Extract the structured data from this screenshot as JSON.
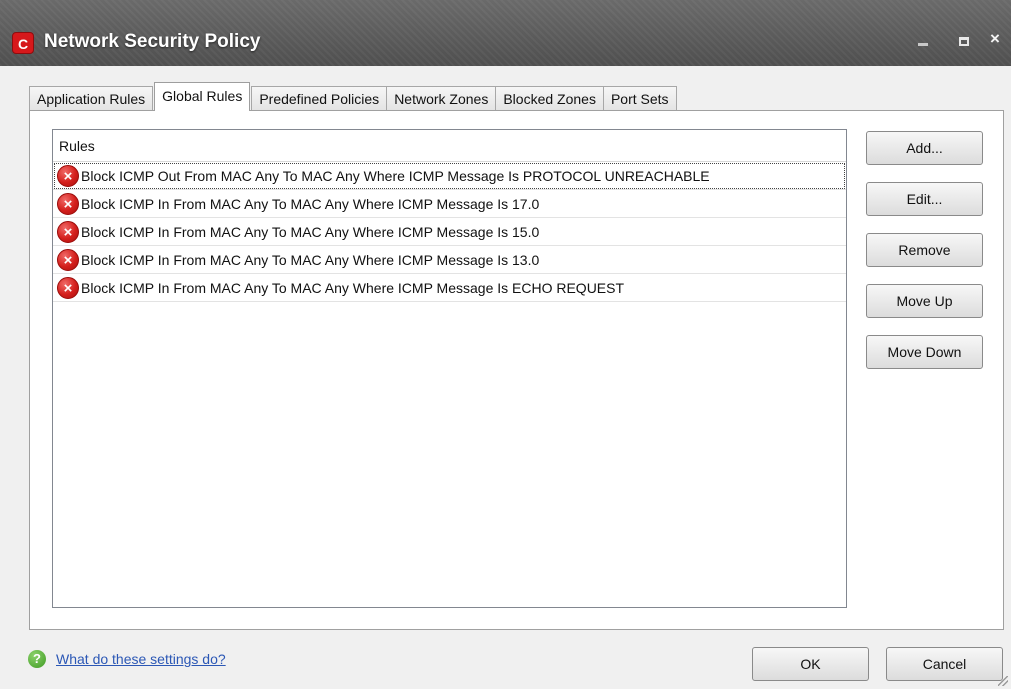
{
  "window": {
    "title": "Network Security Policy",
    "app_icon_glyph": "C",
    "controls": {
      "minimize": "minimize-icon",
      "maximize": "maximize-icon",
      "close": "×"
    }
  },
  "tabs": [
    {
      "label": "Application Rules",
      "active": false
    },
    {
      "label": "Global Rules",
      "active": true
    },
    {
      "label": "Predefined Policies",
      "active": false
    },
    {
      "label": "Network Zones",
      "active": false
    },
    {
      "label": "Blocked Zones",
      "active": false
    },
    {
      "label": "Port Sets",
      "active": false
    }
  ],
  "rules": {
    "header": "Rules",
    "items": [
      {
        "text": "Block ICMP Out From MAC Any To MAC Any Where ICMP Message Is PROTOCOL UNREACHABLE",
        "icon": "block-icon"
      },
      {
        "text": "Block ICMP In From MAC Any To MAC Any Where ICMP Message Is 17.0",
        "icon": "block-icon"
      },
      {
        "text": "Block ICMP In From MAC Any To MAC Any Where ICMP Message Is 15.0",
        "icon": "block-icon"
      },
      {
        "text": "Block ICMP In From MAC Any To MAC Any Where ICMP Message Is 13.0",
        "icon": "block-icon"
      },
      {
        "text": "Block ICMP In From MAC Any To MAC Any Where ICMP Message Is ECHO REQUEST",
        "icon": "block-icon"
      }
    ]
  },
  "side_buttons": {
    "add": "Add...",
    "edit": "Edit...",
    "remove": "Remove",
    "move_up": "Move Up",
    "move_down": "Move Down"
  },
  "footer": {
    "help_link": "What do these settings do?",
    "ok": "OK",
    "cancel": "Cancel"
  },
  "colors": {
    "titlebar": "#5b5b5b",
    "block_icon": "#d41f1c",
    "help_icon": "#3f9a23",
    "link": "#2b57b5"
  }
}
